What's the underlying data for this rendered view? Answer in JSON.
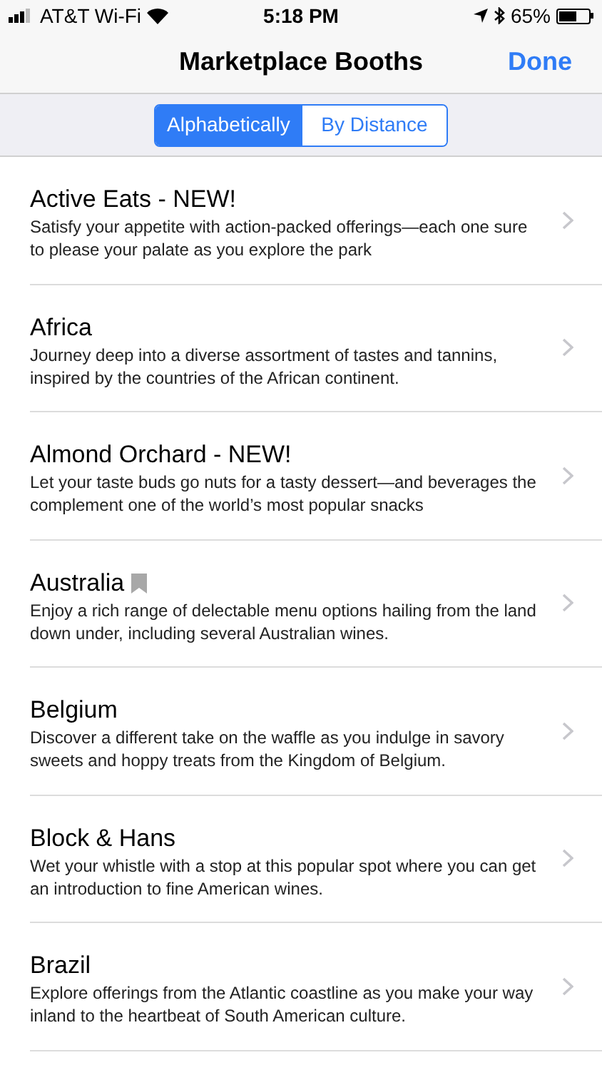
{
  "status_bar": {
    "carrier": "AT&T Wi-Fi",
    "time": "5:18 PM",
    "battery": "65%"
  },
  "nav": {
    "title": "Marketplace Booths",
    "done": "Done"
  },
  "segments": [
    {
      "label": "Alphabetically",
      "selected": true
    },
    {
      "label": "By Distance",
      "selected": false
    }
  ],
  "booths": [
    {
      "name": "Active Eats - NEW!",
      "bookmarked": false,
      "description": "Satisfy your appetite with action-packed offerings—each one sure to please your palate as you explore the park"
    },
    {
      "name": "Africa",
      "bookmarked": false,
      "description": "Journey deep into a diverse assortment of tastes and tannins, inspired by the countries of the African continent."
    },
    {
      "name": "Almond Orchard - NEW!",
      "bookmarked": false,
      "description": "Let your taste buds go nuts for a tasty dessert—and beverages the complement one of the world’s most popular snacks"
    },
    {
      "name": "Australia",
      "bookmarked": true,
      "description": "Enjoy a rich range of delectable menu options hailing from the land down under, including several Australian wines."
    },
    {
      "name": "Belgium",
      "bookmarked": false,
      "description": "Discover a different take on the waffle as you indulge in savory sweets and hoppy treats from the Kingdom of Belgium."
    },
    {
      "name": "Block & Hans",
      "bookmarked": false,
      "description": "Wet your whistle with a stop at this popular spot where you can get an introduction to fine American wines."
    },
    {
      "name": "Brazil",
      "bookmarked": false,
      "description": "Explore offerings from the Atlantic coastline as you make your way inland to the heartbeat of South American culture."
    }
  ]
}
